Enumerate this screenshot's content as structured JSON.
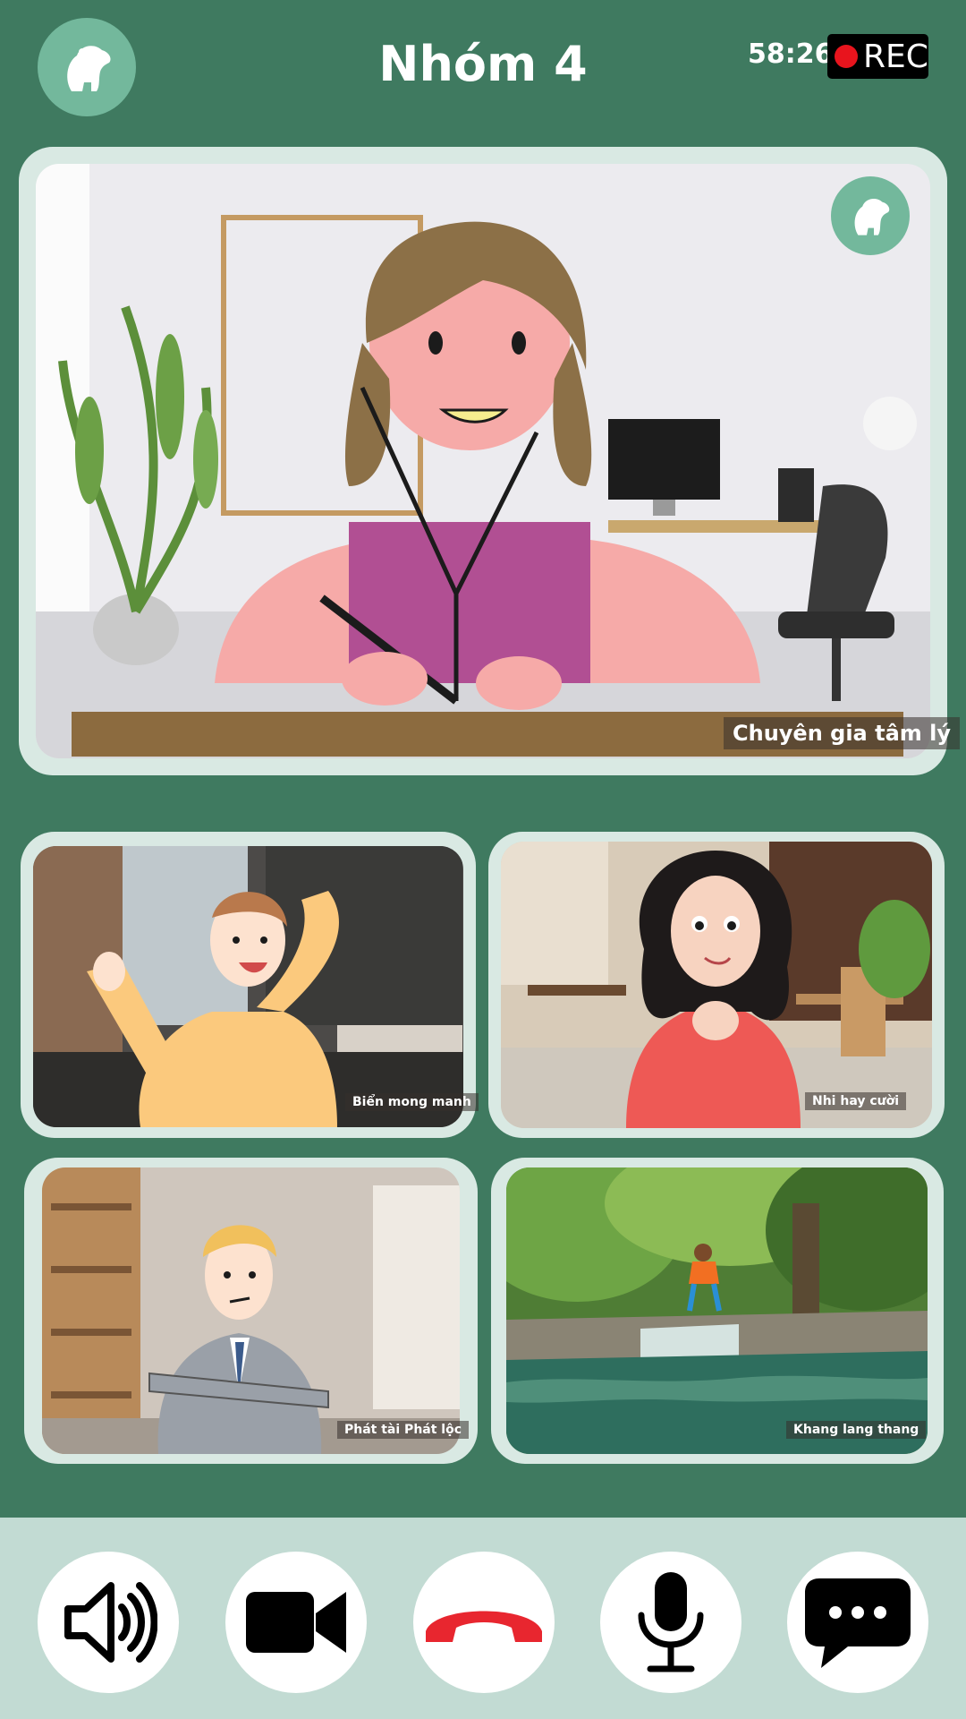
{
  "header": {
    "title": "Nhóm 4",
    "timer": "58:26",
    "rec_label": "REC"
  },
  "main_tile": {
    "name": "Chuyên gia tâm lý"
  },
  "participants": [
    {
      "name": "Biển mong manh"
    },
    {
      "name": "Nhi hay cười"
    },
    {
      "name": "Phát tài Phát lộc"
    },
    {
      "name": "Khang lang thang"
    }
  ],
  "controls": [
    {
      "name": "speaker-icon"
    },
    {
      "name": "video-camera-icon"
    },
    {
      "name": "end-call-icon"
    },
    {
      "name": "microphone-icon"
    },
    {
      "name": "chat-icon"
    }
  ],
  "colors": {
    "background": "#3f7a60",
    "tile_border": "#d9e9e3",
    "logo_circle": "#73b89c",
    "bottom_bar": "#c2dbd3",
    "end_call_red": "#e8262f",
    "rec_dot": "#e8141d"
  }
}
